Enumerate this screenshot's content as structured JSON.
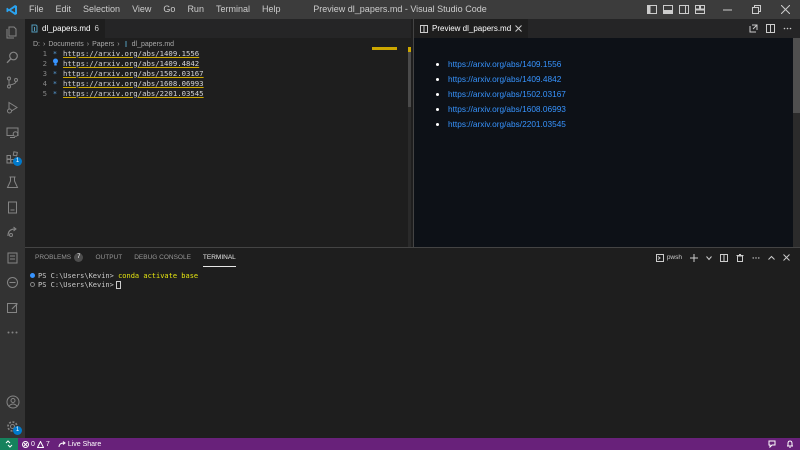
{
  "window": {
    "title": "Preview dl_papers.md - Visual Studio Code",
    "menu": [
      "File",
      "Edit",
      "Selection",
      "View",
      "Go",
      "Run",
      "Terminal",
      "Help"
    ]
  },
  "activity_bar": {
    "items": [
      "explorer-icon",
      "search-icon",
      "source-control-icon",
      "run-debug-icon",
      "remote-explorer-icon",
      "extensions-icon",
      "testing-icon",
      "notebook-icon",
      "live-share-icon",
      "docker-icon",
      "minus-circle-icon",
      "edit-icon",
      "more-icon"
    ],
    "extensions_badge": "1",
    "bottom": [
      "account-icon",
      "settings-icon"
    ],
    "settings_badge": "1"
  },
  "editor": {
    "tab": {
      "label": "dl_papers.md",
      "dirty_count": "6"
    },
    "breadcrumb": [
      "D:",
      "Documents",
      "Papers",
      "dl_papers.md"
    ],
    "lines": [
      {
        "num": "1",
        "bullet": "*",
        "text": "https://arxiv.org/abs/1409.1556"
      },
      {
        "num": "2",
        "bullet": "*",
        "text": "https://arxiv.org/abs/1409.4842"
      },
      {
        "num": "3",
        "bullet": "*",
        "text": "https://arxiv.org/abs/1502.03167"
      },
      {
        "num": "4",
        "bullet": "*",
        "text": "https://arxiv.org/abs/1608.06993"
      },
      {
        "num": "5",
        "bullet": "*",
        "text": "https://arxiv.org/abs/2201.03545"
      }
    ]
  },
  "preview": {
    "tab_label": "Preview dl_papers.md",
    "links": [
      "https://arxiv.org/abs/1409.1556",
      "https://arxiv.org/abs/1409.4842",
      "https://arxiv.org/abs/1502.03167",
      "https://arxiv.org/abs/1608.06993",
      "https://arxiv.org/abs/2201.03545"
    ]
  },
  "panel": {
    "tabs": [
      {
        "label": "PROBLEMS",
        "badge": "7"
      },
      {
        "label": "OUTPUT"
      },
      {
        "label": "DEBUG CONSOLE"
      },
      {
        "label": "TERMINAL"
      }
    ],
    "shell": "pwsh",
    "terminal_lines": [
      {
        "prompt": "PS C:\\Users\\Kevin>",
        "command": "conda activate base",
        "dot_color": "#3794ff"
      },
      {
        "prompt": "PS C:\\Users\\Kevin>",
        "command": "",
        "dot_color": "#858585"
      }
    ]
  },
  "status_bar": {
    "errors": "0",
    "warnings": "7",
    "live_share": "Live Share",
    "colors": {
      "background": "#68217a",
      "remote": "#16825d"
    }
  }
}
